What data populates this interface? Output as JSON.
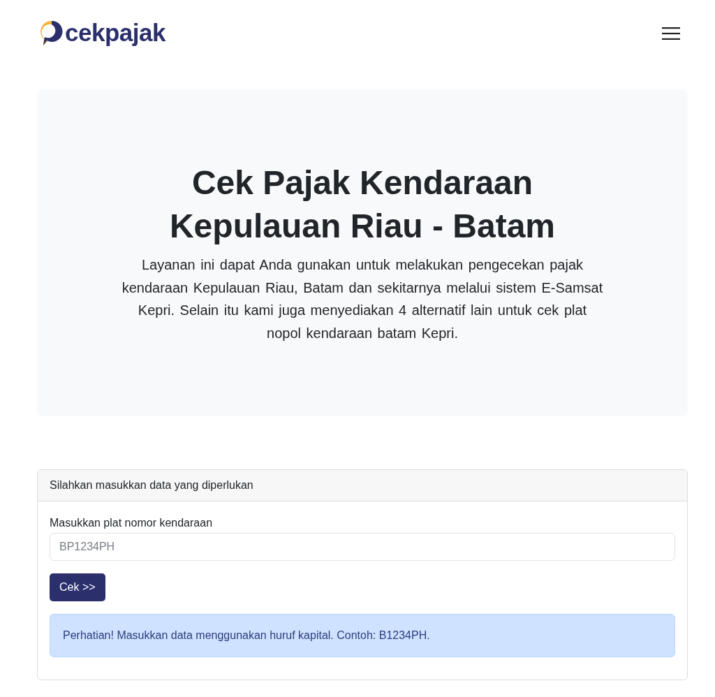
{
  "header": {
    "logo_text": "cekpajak"
  },
  "hero": {
    "title": "Cek Pajak Kendaraan Kepulauan Riau - Batam",
    "description": "Layanan ini dapat Anda gunakan untuk melakukan pengecekan pajak kendaraan Kepulauan Riau, Batam dan sekitarnya melalui sistem E-Samsat Kepri. Selain itu kami juga menyediakan 4 alternatif lain untuk cek plat nopol kendaraan batam Kepri."
  },
  "form_card": {
    "header": "Silahkan masukkan data yang diperlukan",
    "field": {
      "label": "Masukkan plat nomor kendaraan",
      "placeholder": "BP1234PH"
    },
    "submit_button": "Cek >>",
    "alert": "Perhatian! Masukkan data menggunakan huruf kapital. Contoh: B1234PH."
  }
}
